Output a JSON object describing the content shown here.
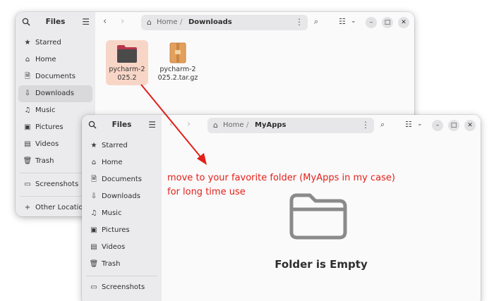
{
  "back_window": {
    "title": "Files",
    "sidebar": [
      {
        "label": "Starred",
        "icon": "star-icon"
      },
      {
        "label": "Home",
        "icon": "home-icon"
      },
      {
        "label": "Documents",
        "icon": "document-icon"
      },
      {
        "label": "Downloads",
        "icon": "download-icon",
        "active": true
      },
      {
        "label": "Music",
        "icon": "music-icon"
      },
      {
        "label": "Pictures",
        "icon": "picture-icon"
      },
      {
        "label": "Videos",
        "icon": "video-icon"
      },
      {
        "label": "Trash",
        "icon": "trash-icon"
      },
      {
        "label": "Screenshots",
        "icon": "folder-icon"
      },
      {
        "label": "Other Locations",
        "icon": "plus-icon"
      }
    ],
    "path": {
      "home": "Home",
      "separator": "/",
      "current": "Downloads"
    },
    "files": [
      {
        "label_line1": "pycharm-2",
        "label_line2": "025.2",
        "type": "folder",
        "selected": true
      },
      {
        "label_line1": "pycharm-2",
        "label_line2": "025.2.tar.gz",
        "type": "archive",
        "selected": false
      }
    ]
  },
  "front_window": {
    "title": "Files",
    "sidebar": [
      {
        "label": "Starred",
        "icon": "star-icon"
      },
      {
        "label": "Home",
        "icon": "home-icon"
      },
      {
        "label": "Documents",
        "icon": "document-icon"
      },
      {
        "label": "Downloads",
        "icon": "download-icon"
      },
      {
        "label": "Music",
        "icon": "music-icon"
      },
      {
        "label": "Pictures",
        "icon": "picture-icon"
      },
      {
        "label": "Videos",
        "icon": "video-icon"
      },
      {
        "label": "Trash",
        "icon": "trash-icon"
      },
      {
        "label": "Screenshots",
        "icon": "folder-icon"
      }
    ],
    "path": {
      "home": "Home",
      "separator": "/",
      "current": "MyApps"
    },
    "empty_message": "Folder is Empty"
  },
  "annotation": {
    "line1": "move to your favorite folder  (MyApps in my case)",
    "line2": "for long time use",
    "color": "#e3201a"
  },
  "colors": {
    "selection": "#f8d6c7",
    "sidebar_bg": "#ebebed",
    "folder_dark": "#4a4a4a",
    "folder_tab": "#b8344a",
    "archive": "#e2a05c"
  }
}
